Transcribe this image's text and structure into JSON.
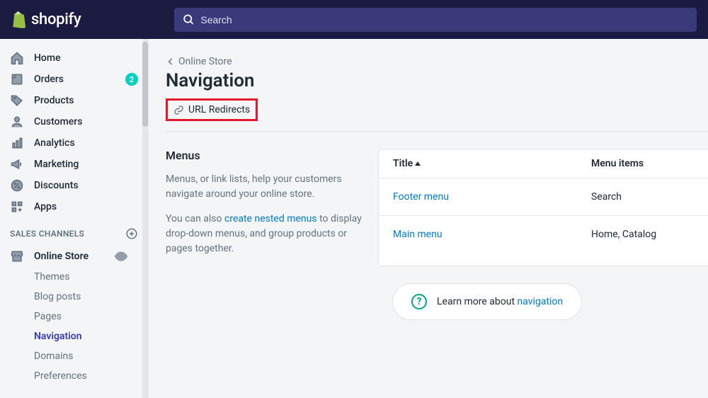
{
  "header": {
    "brand": "shopify",
    "search_placeholder": "Search"
  },
  "sidebar": {
    "main": [
      {
        "label": "Home",
        "badge": ""
      },
      {
        "label": "Orders",
        "badge": "2"
      },
      {
        "label": "Products",
        "badge": ""
      },
      {
        "label": "Customers",
        "badge": ""
      },
      {
        "label": "Analytics",
        "badge": ""
      },
      {
        "label": "Marketing",
        "badge": ""
      },
      {
        "label": "Discounts",
        "badge": ""
      },
      {
        "label": "Apps",
        "badge": ""
      }
    ],
    "channels_title": "SALES CHANNELS",
    "channel_label": "Online Store",
    "sub": [
      {
        "label": "Themes"
      },
      {
        "label": "Blog posts"
      },
      {
        "label": "Pages"
      },
      {
        "label": "Navigation"
      },
      {
        "label": "Domains"
      },
      {
        "label": "Preferences"
      }
    ]
  },
  "breadcrumb": "Online Store",
  "page_title": "Navigation",
  "url_redirects_label": "URL Redirects",
  "menus": {
    "heading": "Menus",
    "p1_a": "Menus, or link lists, help your customers navigate around your online store.",
    "p2_a": "You can also ",
    "p2_link": "create nested menus",
    "p2_b": " to display drop-down menus, and group products or pages together.",
    "col_title": "Title",
    "col_items": "Menu items",
    "rows": [
      {
        "title": "Footer menu",
        "items": "Search"
      },
      {
        "title": "Main menu",
        "items": "Home, Catalog"
      }
    ]
  },
  "learn": {
    "text": "Learn more about ",
    "link": "navigation"
  }
}
